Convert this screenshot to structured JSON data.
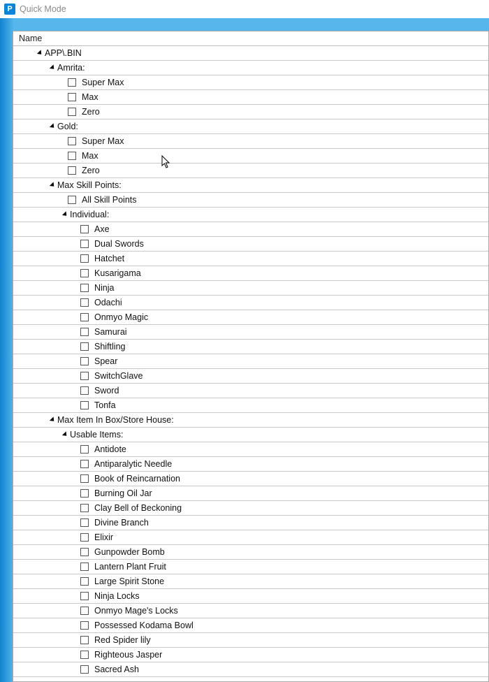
{
  "window": {
    "title": "Quick Mode",
    "icon_letter": "P"
  },
  "header": {
    "name_col": "Name"
  },
  "tree_root": "APP\\.BIN",
  "groups": [
    {
      "label": "Amrita:",
      "items": [
        "Super Max",
        "Max",
        "Zero"
      ]
    },
    {
      "label": "Gold:",
      "items": [
        "Super Max",
        "Max",
        "Zero"
      ]
    },
    {
      "label": "Max Skill Points:",
      "items": [
        "All Skill Points"
      ],
      "subgroups": [
        {
          "label": "Individual:",
          "items": [
            "Axe",
            "Dual Swords",
            "Hatchet",
            "Kusarigama",
            "Ninja",
            "Odachi",
            "Onmyo Magic",
            "Samurai",
            "Shiftling",
            "Spear",
            "SwitchGlave",
            "Sword",
            "Tonfa"
          ]
        }
      ]
    },
    {
      "label": "Max Item In Box/Store House:",
      "subgroups": [
        {
          "label": "Usable Items:",
          "items": [
            "Antidote",
            "Antiparalytic Needle",
            "Book of Reincarnation",
            "Burning Oil Jar",
            "Clay Bell of Beckoning",
            "Divine Branch",
            "Elixir",
            "Gunpowder Bomb",
            "Lantern Plant Fruit",
            "Large Spirit Stone",
            "Ninja Locks",
            "Onmyo Mage's Locks",
            "Possessed Kodama Bowl",
            "Red Spider lily",
            "Righteous Jasper",
            "Sacred Ash"
          ]
        }
      ]
    }
  ]
}
